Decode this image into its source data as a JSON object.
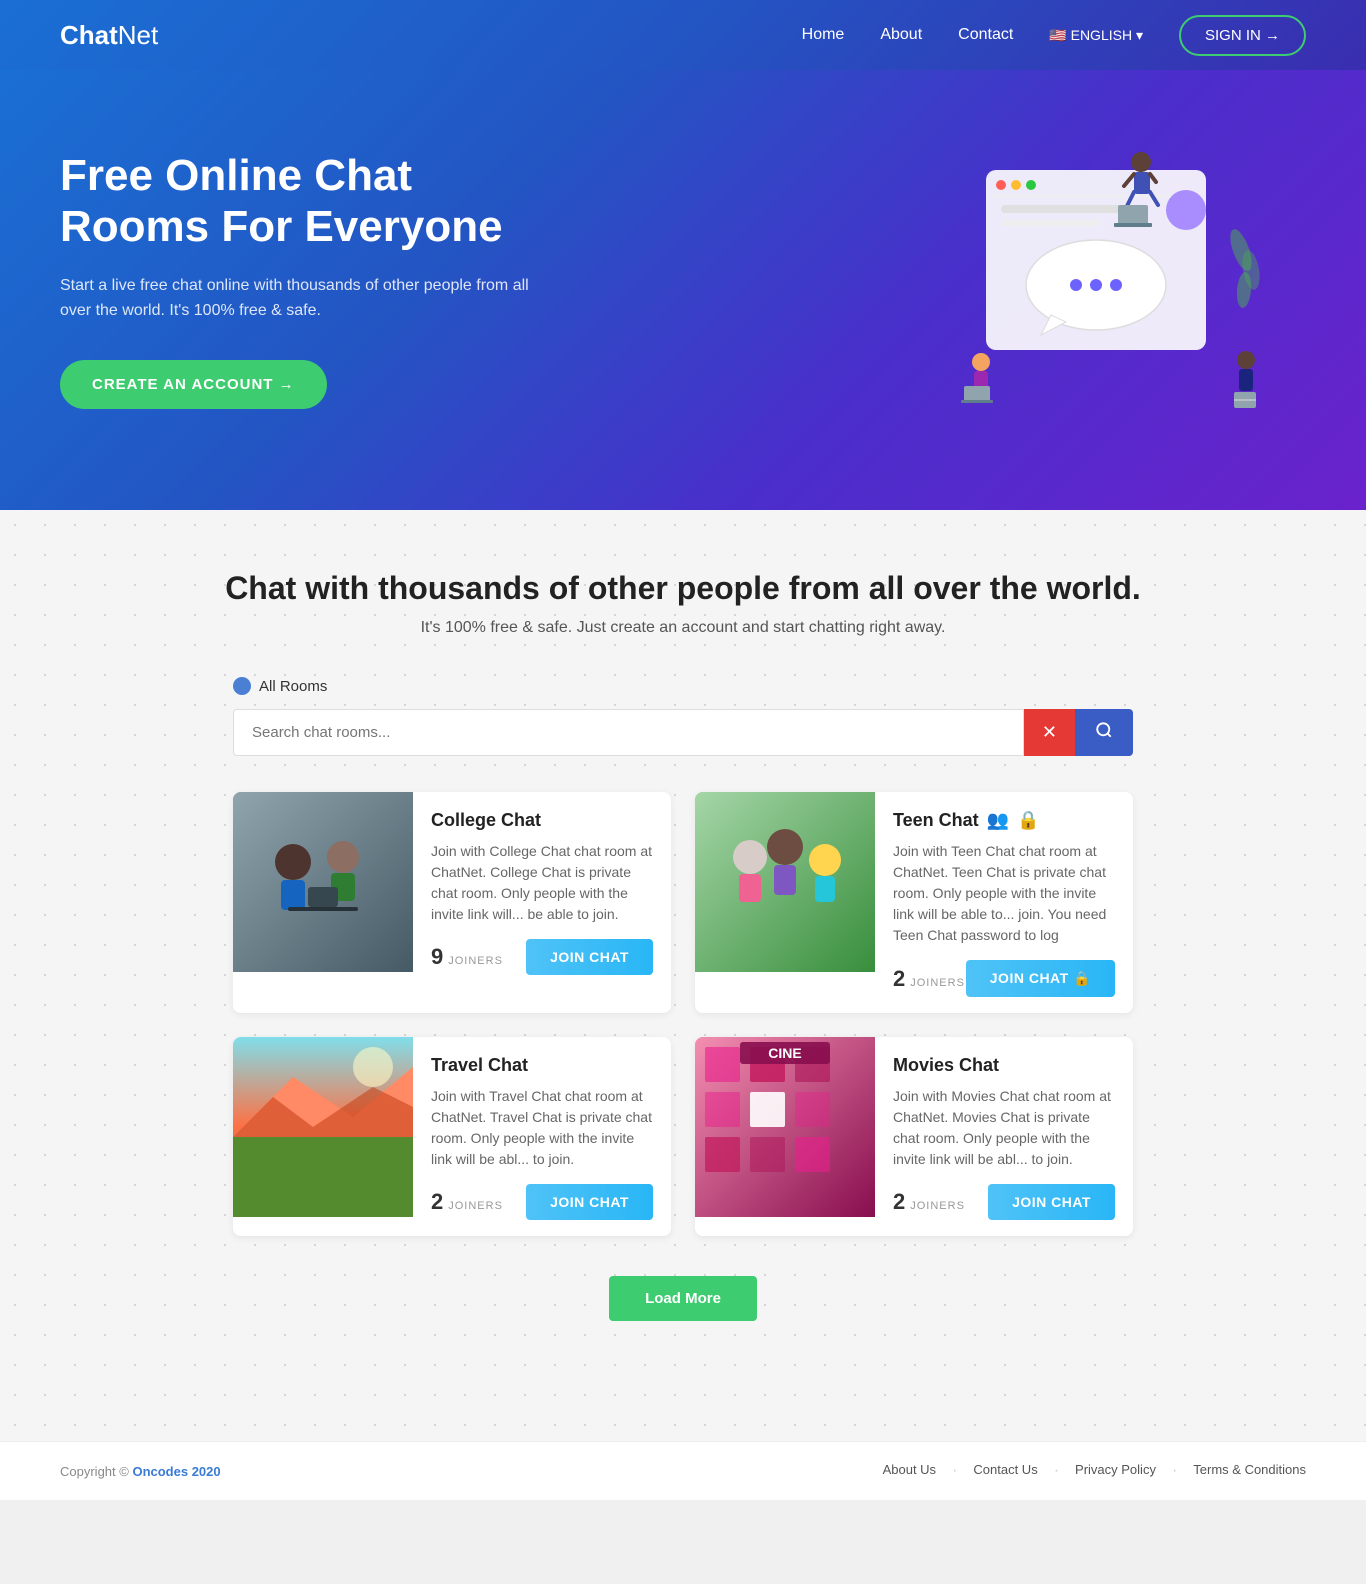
{
  "brand": {
    "name_bold": "Chat",
    "name_light": "Net"
  },
  "navbar": {
    "links": [
      {
        "label": "Home",
        "href": "#"
      },
      {
        "label": "About",
        "href": "#"
      },
      {
        "label": "Contact",
        "href": "#"
      }
    ],
    "lang": "🇺🇸 ENGLISH ▾",
    "signin_label": "SIGN IN →"
  },
  "hero": {
    "title": "Free Online Chat Rooms For Everyone",
    "subtitle": "Start a live free chat online with thousands of other people from all over the world. It's 100% free & safe.",
    "cta_label": "CREATE AN ACCOUNT →"
  },
  "main": {
    "section_title": "Chat with thousands of other people from all over the world.",
    "section_subtitle": "It's 100% free &amp; safe. Just create an account and start chatting right away.",
    "filter_label": "All Rooms",
    "search_placeholder": "Search chat rooms...",
    "search_clear": "✕",
    "search_icon": "🔍"
  },
  "rooms": [
    {
      "id": "college",
      "title": "College Chat",
      "description": "Join with College Chat chat room at ChatNet. College Chat is private chat room. Only people with the invite link will... be able to join.",
      "joiners": "9",
      "join_label": "JOIN CHAT",
      "locked": false,
      "img_class": "img-college"
    },
    {
      "id": "teen",
      "title": "Teen Chat",
      "description": "Join with Teen Chat chat room at ChatNet. Teen Chat is private chat room. Only people with the invite link will be able to... join. You need Teen Chat password to log",
      "joiners": "2",
      "join_label": "JOIN CHAT 🔒",
      "locked": true,
      "img_class": "img-teen"
    },
    {
      "id": "travel",
      "title": "Travel Chat",
      "description": "Join with Travel Chat chat room at ChatNet. Travel Chat is private chat room. Only people with the invite link will be abl... to join.",
      "joiners": "2",
      "join_label": "JOIN CHAT",
      "locked": false,
      "img_class": "img-travel"
    },
    {
      "id": "movies",
      "title": "Movies Chat",
      "description": "Join with Movies Chat chat room at ChatNet. Movies Chat is private chat room. Only people with the invite link will be abl... to join.",
      "joiners": "2",
      "join_label": "JOIN CHAT",
      "locked": false,
      "img_class": "img-movies"
    }
  ],
  "load_more_label": "Load More",
  "footer": {
    "copy": "Copyright © Oncodes 2020",
    "links": [
      {
        "label": "About Us"
      },
      {
        "label": "Contact Us"
      },
      {
        "label": "Privacy Policy"
      },
      {
        "label": "Terms & Conditions"
      }
    ]
  }
}
